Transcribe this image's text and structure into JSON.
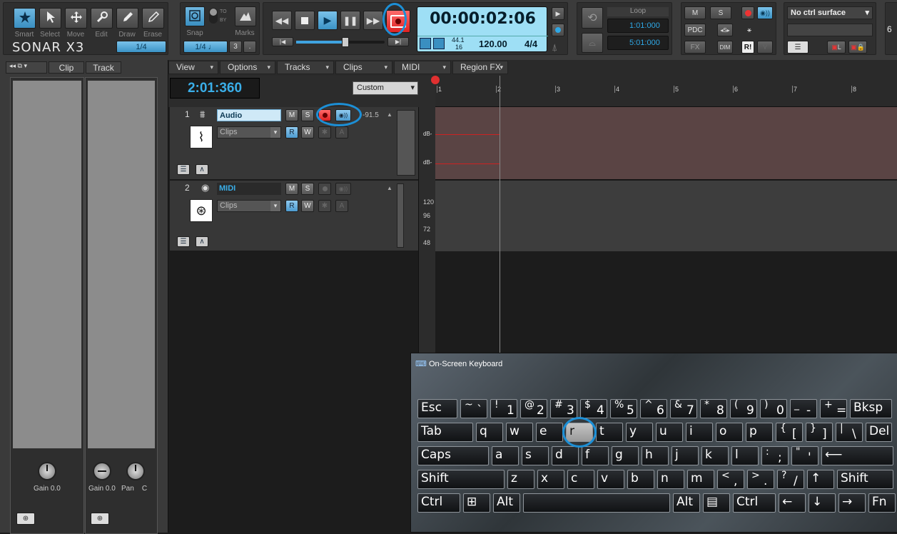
{
  "app": {
    "logo": "SONAR X3"
  },
  "tools": [
    {
      "name": "smart",
      "label": "Smart",
      "icon": "star-icon"
    },
    {
      "name": "select",
      "label": "Select",
      "icon": "arrow-pointer-icon"
    },
    {
      "name": "move",
      "label": "Move",
      "icon": "move-icon"
    },
    {
      "name": "edit",
      "label": "Edit",
      "icon": "wrench-icon"
    },
    {
      "name": "draw",
      "label": "Draw",
      "icon": "pencil-icon"
    },
    {
      "name": "erase",
      "label": "Erase",
      "icon": "eraser-icon"
    }
  ],
  "tool_value": "1/4",
  "snap": {
    "label": "Snap",
    "to": "TO",
    "by": "BY",
    "value": "1/4",
    "marks_label": "Marks",
    "marks_value": "3",
    "dot": "."
  },
  "transport": {
    "time": "00:00:02:06",
    "rate_top": "44.1",
    "rate_bot": "16",
    "tempo": "120.00",
    "meter": "4/4"
  },
  "loop": {
    "label": "Loop",
    "start": "1:01:000",
    "end": "5:01:000"
  },
  "mix": {
    "m": "M",
    "s": "S",
    "pdc": "PDC",
    "fx": "FX",
    "dim": "DIM",
    "r": "R!"
  },
  "ctrl_surface": "No ctrl surface",
  "side_edge": "6",
  "inspector": {
    "tabs": [
      "Clip",
      "Track"
    ],
    "gain1_label": "Gain",
    "gain1_val": "0.0",
    "gain2_label": "Gain",
    "gain2_val": "0.0",
    "pan_label": "Pan",
    "pan_val": "C"
  },
  "menus": [
    "View",
    "Options",
    "Tracks",
    "Clips",
    "MIDI",
    "Region FX"
  ],
  "now_time": "2:01:360",
  "view_preset": "Custom",
  "ruler": [
    "1",
    "2",
    "3",
    "4",
    "5",
    "6",
    "7",
    "8"
  ],
  "tracks": [
    {
      "num": "1",
      "name": "Audio",
      "input": "Clips",
      "vol": "-91.5",
      "m": "M",
      "s": "S",
      "r": "R",
      "w": "W",
      "a": "A"
    },
    {
      "num": "2",
      "name": "MIDI",
      "input": "Clips",
      "m": "M",
      "s": "S",
      "r": "R",
      "w": "W",
      "a": "A"
    }
  ],
  "db_label": "dB-",
  "midi_scale": [
    "120",
    "96",
    "72",
    "48"
  ],
  "osk": {
    "title": "On-Screen Keyboard",
    "rows": [
      [
        {
          "c": "Esc",
          "w": 56
        },
        {
          "s": "~",
          "m": "`",
          "w": 38
        },
        {
          "s": "!",
          "m": "1",
          "w": 38
        },
        {
          "s": "@",
          "m": "2",
          "w": 38
        },
        {
          "s": "#",
          "m": "3",
          "w": 38
        },
        {
          "s": "$",
          "m": "4",
          "w": 38
        },
        {
          "s": "%",
          "m": "5",
          "w": 38
        },
        {
          "s": "^",
          "m": "6",
          "w": 38
        },
        {
          "s": "&",
          "m": "7",
          "w": 38
        },
        {
          "s": "*",
          "m": "8",
          "w": 38
        },
        {
          "s": "(",
          "m": "9",
          "w": 38
        },
        {
          "s": ")",
          "m": "0",
          "w": 38
        },
        {
          "s": "_",
          "m": "-",
          "w": 38
        },
        {
          "s": "+",
          "m": "=",
          "w": 38
        },
        {
          "c": "Bksp",
          "w": 59
        }
      ],
      [
        {
          "c": "Tab",
          "w": 78
        },
        {
          "c": "q",
          "w": 38
        },
        {
          "c": "w",
          "w": 38
        },
        {
          "c": "e",
          "w": 38
        },
        {
          "c": "r",
          "w": 38,
          "hl": true
        },
        {
          "c": "t",
          "w": 38
        },
        {
          "c": "y",
          "w": 38
        },
        {
          "c": "u",
          "w": 38
        },
        {
          "c": "i",
          "w": 38
        },
        {
          "c": "o",
          "w": 38
        },
        {
          "c": "p",
          "w": 38
        },
        {
          "s": "{",
          "m": "[",
          "w": 38
        },
        {
          "s": "}",
          "m": "]",
          "w": 38
        },
        {
          "s": "|",
          "m": "\\",
          "w": 38
        },
        {
          "c": "Del",
          "w": 37
        }
      ],
      [
        {
          "c": "Caps",
          "w": 100
        },
        {
          "c": "a",
          "w": 38
        },
        {
          "c": "s",
          "w": 38
        },
        {
          "c": "d",
          "w": 38
        },
        {
          "c": "f",
          "w": 38
        },
        {
          "c": "g",
          "w": 38
        },
        {
          "c": "h",
          "w": 38
        },
        {
          "c": "j",
          "w": 38
        },
        {
          "c": "k",
          "w": 38
        },
        {
          "c": "l",
          "w": 38
        },
        {
          "s": ":",
          "m": ";",
          "w": 38
        },
        {
          "s": "\"",
          "m": "'",
          "w": 38
        },
        {
          "c": "⟵",
          "w": 101
        }
      ],
      [
        {
          "c": "Shift",
          "w": 122
        },
        {
          "c": "z",
          "w": 38
        },
        {
          "c": "x",
          "w": 38
        },
        {
          "c": "c",
          "w": 38
        },
        {
          "c": "v",
          "w": 38
        },
        {
          "c": "b",
          "w": 38
        },
        {
          "c": "n",
          "w": 38
        },
        {
          "c": "m",
          "w": 38
        },
        {
          "s": "<",
          "m": ",",
          "w": 38
        },
        {
          "s": ">",
          "m": ".",
          "w": 38
        },
        {
          "s": "?",
          "m": "/",
          "w": 38
        },
        {
          "c": "↑",
          "w": 38
        },
        {
          "c": "Shift",
          "w": 79
        }
      ],
      [
        {
          "c": "Ctrl",
          "w": 60
        },
        {
          "c": "⊞",
          "w": 38
        },
        {
          "c": "Alt",
          "w": 38
        },
        {
          "c": "",
          "w": 206
        },
        {
          "c": "Alt",
          "w": 38
        },
        {
          "c": "▤",
          "w": 38
        },
        {
          "c": "Ctrl",
          "w": 60
        },
        {
          "c": "←",
          "w": 38
        },
        {
          "c": "↓",
          "w": 38
        },
        {
          "c": "→",
          "w": 38
        },
        {
          "c": "Fn",
          "w": 38
        }
      ]
    ]
  }
}
